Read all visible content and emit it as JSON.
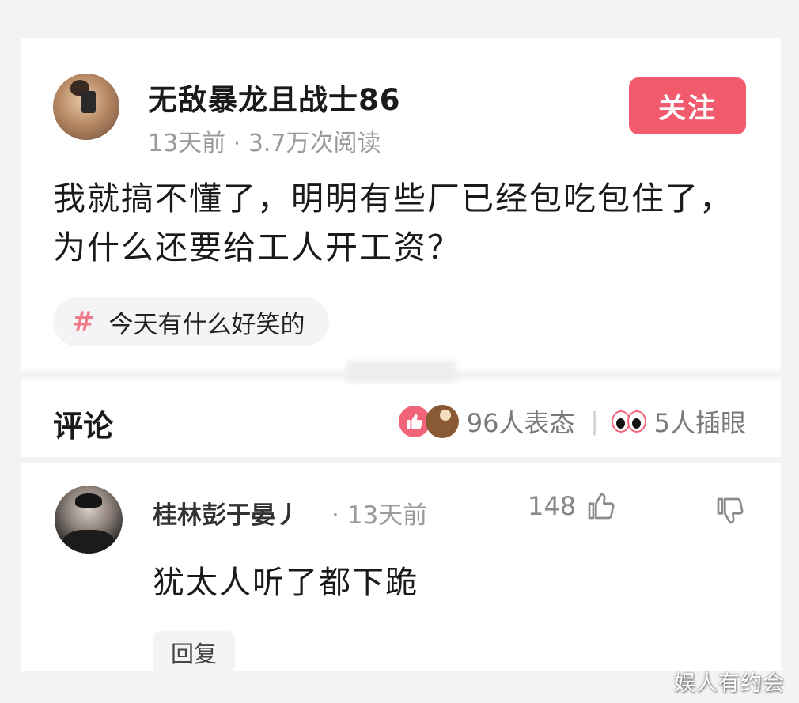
{
  "post": {
    "author": "无敌暴龙且战士86",
    "time": "13天前",
    "views": "3.7万次阅读",
    "follow_label": "关注",
    "text": "我就搞不懂了，明明有些厂已经包吃包住了，为什么还要给工人开工资？",
    "topic": "今天有什么好笑的",
    "topic_symbol": "#"
  },
  "comments_section": {
    "title": "评论",
    "reactions_label": "96人表态",
    "separator": "|",
    "eyes_label": "5人插眼"
  },
  "comment": {
    "author": "桂林彭于晏丿",
    "time": "13天前",
    "likes": "148",
    "text": "犹太人听了都下跪",
    "reply_label": "回复"
  },
  "watermark": "娱人有约会",
  "colors": {
    "accent": "#f25a6e",
    "muted_text": "#9a9a9a",
    "chip_bg": "#f4f4f6"
  }
}
